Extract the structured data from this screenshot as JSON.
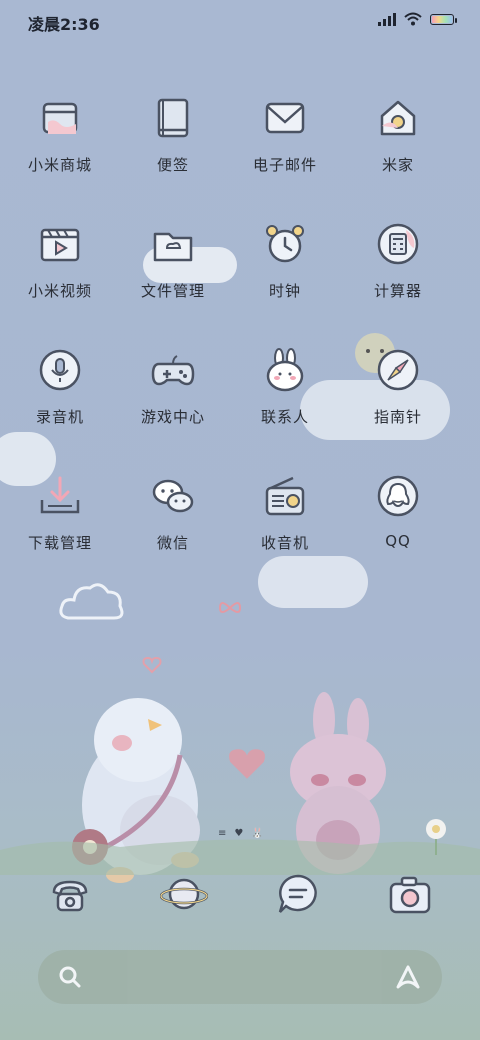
{
  "status_bar": {
    "time": "凌晨2:36",
    "battery_level": 1.0
  },
  "apps": [
    {
      "label": "小米商城",
      "icon": "store-icon"
    },
    {
      "label": "便签",
      "icon": "notes-icon"
    },
    {
      "label": "电子邮件",
      "icon": "mail-icon"
    },
    {
      "label": "米家",
      "icon": "home-icon"
    },
    {
      "label": "小米视频",
      "icon": "video-icon"
    },
    {
      "label": "文件管理",
      "icon": "folder-icon"
    },
    {
      "label": "时钟",
      "icon": "alarm-clock-icon"
    },
    {
      "label": "计算器",
      "icon": "calculator-icon"
    },
    {
      "label": "录音机",
      "icon": "microphone-icon"
    },
    {
      "label": "游戏中心",
      "icon": "gamepad-icon"
    },
    {
      "label": "联系人",
      "icon": "bunny-contacts-icon"
    },
    {
      "label": "指南针",
      "icon": "compass-icon"
    },
    {
      "label": "下载管理",
      "icon": "download-icon"
    },
    {
      "label": "微信",
      "icon": "wechat-icon"
    },
    {
      "label": "收音机",
      "icon": "radio-icon"
    },
    {
      "label": "QQ",
      "icon": "qq-penguin-icon"
    }
  ],
  "dock": [
    {
      "icon": "phone-icon"
    },
    {
      "icon": "planet-browser-icon"
    },
    {
      "icon": "message-icon"
    },
    {
      "icon": "camera-icon"
    }
  ],
  "page_indicator": {
    "current": 1,
    "symbols": [
      "≡",
      "♥",
      "🐰"
    ]
  },
  "search_bar": {
    "icon": "search-icon",
    "assistant_icon": "assistant-icon"
  }
}
